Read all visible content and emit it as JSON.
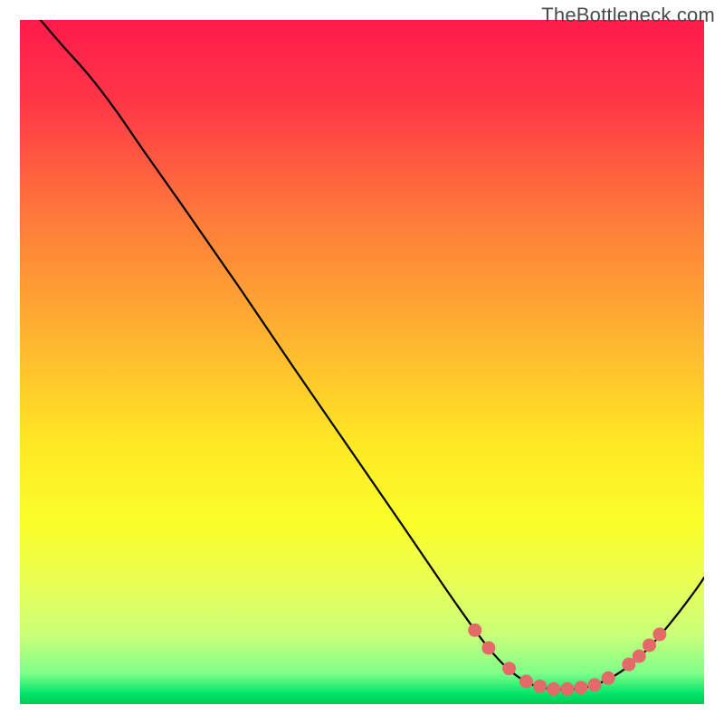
{
  "watermark": "TheBottleneck.com",
  "chart_data": {
    "type": "line",
    "title": "",
    "xlabel": "",
    "ylabel": "",
    "x_range": [
      0,
      100
    ],
    "y_range": [
      0,
      100
    ],
    "background_gradient": {
      "stops": [
        {
          "offset": 0.0,
          "color": "#ff1a4b"
        },
        {
          "offset": 0.12,
          "color": "#ff3747"
        },
        {
          "offset": 0.3,
          "color": "#ff7e3a"
        },
        {
          "offset": 0.48,
          "color": "#ffb92f"
        },
        {
          "offset": 0.62,
          "color": "#ffe824"
        },
        {
          "offset": 0.74,
          "color": "#faff2b"
        },
        {
          "offset": 0.82,
          "color": "#eaff55"
        },
        {
          "offset": 0.9,
          "color": "#c9ff7a"
        },
        {
          "offset": 0.955,
          "color": "#7fff8a"
        },
        {
          "offset": 0.985,
          "color": "#00e56a"
        },
        {
          "offset": 1.0,
          "color": "#00c853"
        }
      ]
    },
    "series": [
      {
        "name": "curve",
        "stroke": "#000000",
        "stroke_width": 2.2,
        "points": [
          {
            "x": 3.0,
            "y": 100.0
          },
          {
            "x": 6.0,
            "y": 96.5
          },
          {
            "x": 10.0,
            "y": 92.0
          },
          {
            "x": 14.0,
            "y": 86.8
          },
          {
            "x": 18.0,
            "y": 81.0
          },
          {
            "x": 24.0,
            "y": 72.5
          },
          {
            "x": 32.0,
            "y": 61.0
          },
          {
            "x": 40.0,
            "y": 49.2
          },
          {
            "x": 48.0,
            "y": 37.6
          },
          {
            "x": 56.0,
            "y": 26.0
          },
          {
            "x": 62.0,
            "y": 17.2
          },
          {
            "x": 66.0,
            "y": 11.5
          },
          {
            "x": 69.0,
            "y": 7.6
          },
          {
            "x": 72.0,
            "y": 4.6
          },
          {
            "x": 75.0,
            "y": 2.8
          },
          {
            "x": 78.0,
            "y": 2.2
          },
          {
            "x": 81.0,
            "y": 2.2
          },
          {
            "x": 84.0,
            "y": 2.8
          },
          {
            "x": 87.0,
            "y": 4.2
          },
          {
            "x": 90.0,
            "y": 6.4
          },
          {
            "x": 93.0,
            "y": 9.4
          },
          {
            "x": 96.0,
            "y": 13.0
          },
          {
            "x": 99.0,
            "y": 17.0
          },
          {
            "x": 100.0,
            "y": 18.5
          }
        ]
      }
    ],
    "dots": {
      "color": "#e46a6a",
      "radius": 7.5,
      "points": [
        {
          "x": 66.5,
          "y": 10.8
        },
        {
          "x": 68.5,
          "y": 8.2
        },
        {
          "x": 71.5,
          "y": 5.2
        },
        {
          "x": 74.0,
          "y": 3.3
        },
        {
          "x": 76.0,
          "y": 2.6
        },
        {
          "x": 78.0,
          "y": 2.2
        },
        {
          "x": 80.0,
          "y": 2.2
        },
        {
          "x": 82.0,
          "y": 2.4
        },
        {
          "x": 84.0,
          "y": 2.8
        },
        {
          "x": 86.0,
          "y": 3.8
        },
        {
          "x": 89.0,
          "y": 5.8
        },
        {
          "x": 90.5,
          "y": 7.0
        },
        {
          "x": 92.0,
          "y": 8.6
        },
        {
          "x": 93.5,
          "y": 10.2
        }
      ]
    }
  }
}
